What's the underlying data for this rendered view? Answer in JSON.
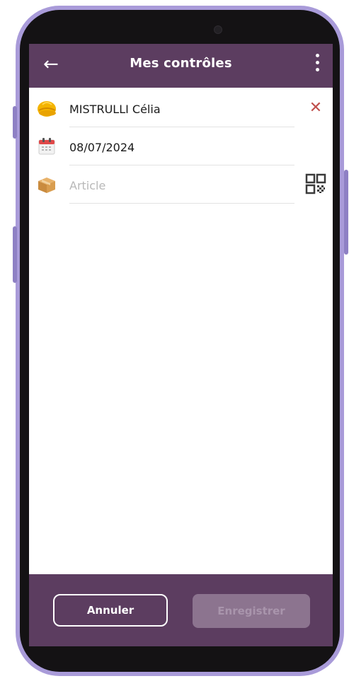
{
  "header": {
    "title": "Mes contrôles",
    "back_icon": "arrow-left-icon",
    "menu_icon": "more-vertical-icon"
  },
  "form": {
    "operator": {
      "value": "MISTRULLI Célia",
      "icon": "hard-hat-icon",
      "clear_icon": "close-icon"
    },
    "date": {
      "value": "08/07/2024",
      "icon": "calendar-icon"
    },
    "article": {
      "placeholder": "Article",
      "value": "",
      "icon": "box-icon",
      "scan_icon": "qr-code-icon"
    }
  },
  "footer": {
    "cancel_label": "Annuler",
    "save_label": "Enregistrer"
  },
  "colors": {
    "primary": "#5c3d60",
    "frame": "#a99bd9",
    "clear_red": "#c0504d",
    "disabled_button": "#8c748f"
  }
}
